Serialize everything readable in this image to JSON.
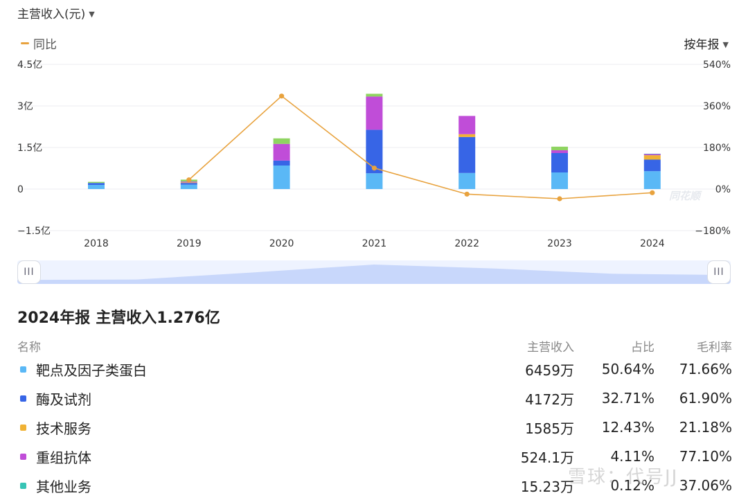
{
  "header": {
    "metric_label": "主营收入(元)",
    "legend_label": "同比",
    "period_label": "按年报"
  },
  "colors": {
    "line": "#e8a23d",
    "segment": [
      "#5ab8f6",
      "#3765e6",
      "#f0b234",
      "#c04dd8",
      "#37c4b5",
      "#8fd461"
    ],
    "slider_fill": "#c8d7fb"
  },
  "chart_data": {
    "type": "bar",
    "stacked": true,
    "categories": [
      "2018",
      "2019",
      "2020",
      "2021",
      "2022",
      "2023",
      "2024"
    ],
    "y_left": {
      "ticks": [
        "4.5亿",
        "3亿",
        "1.5亿",
        "0",
        "−1.5亿"
      ],
      "range": [
        -1.5,
        4.5
      ],
      "unit": "亿"
    },
    "y_right": {
      "ticks": [
        "540%",
        "360%",
        "180%",
        "0%",
        "−180%"
      ],
      "range": [
        -180,
        540
      ],
      "unit": "%"
    },
    "series": [
      {
        "values": [
          0.15,
          0.16,
          0.85,
          0.57,
          0.58,
          0.6,
          0.646
        ]
      },
      {
        "values": [
          0.07,
          0.06,
          0.18,
          1.57,
          1.3,
          0.7,
          0.417
        ]
      },
      {
        "values": [
          0.0,
          0.02,
          0.0,
          0.0,
          0.1,
          0.0,
          0.159
        ]
      },
      {
        "values": [
          0.0,
          0.03,
          0.6,
          1.2,
          0.66,
          0.1,
          0.052
        ]
      },
      {
        "values": [
          0.0,
          0.0,
          0.0,
          0.0,
          0.0,
          0.0,
          0.0015
        ]
      },
      {
        "values": [
          0.04,
          0.07,
          0.2,
          0.1,
          0.0,
          0.13,
          0.0
        ]
      }
    ],
    "line": {
      "values": [
        null,
        40,
        403,
        91,
        -22,
        -42,
        -16
      ]
    },
    "grid": true,
    "legend_position": "top-left",
    "watermark": "同花顺"
  },
  "slider": {
    "left_handle": "III",
    "right_handle": "III"
  },
  "summary": {
    "title": "2024年报",
    "label": "主营收入1.276亿"
  },
  "table": {
    "headers": [
      "名称",
      "主营收入",
      "占比",
      "毛利率"
    ],
    "rows": [
      {
        "name": "靶点及因子类蛋白",
        "revenue": "6459万",
        "share": "50.64%",
        "gross_margin": "71.66%"
      },
      {
        "name": "酶及试剂",
        "revenue": "4172万",
        "share": "32.71%",
        "gross_margin": "61.90%"
      },
      {
        "name": "技术服务",
        "revenue": "1585万",
        "share": "12.43%",
        "gross_margin": "21.18%"
      },
      {
        "name": "重组抗体",
        "revenue": "524.1万",
        "share": "4.11%",
        "gross_margin": "77.10%"
      },
      {
        "name": "其他业务",
        "revenue": "15.23万",
        "share": "0.12%",
        "gross_margin": "37.06%"
      }
    ]
  },
  "watermark": "雪球：代号JJ"
}
